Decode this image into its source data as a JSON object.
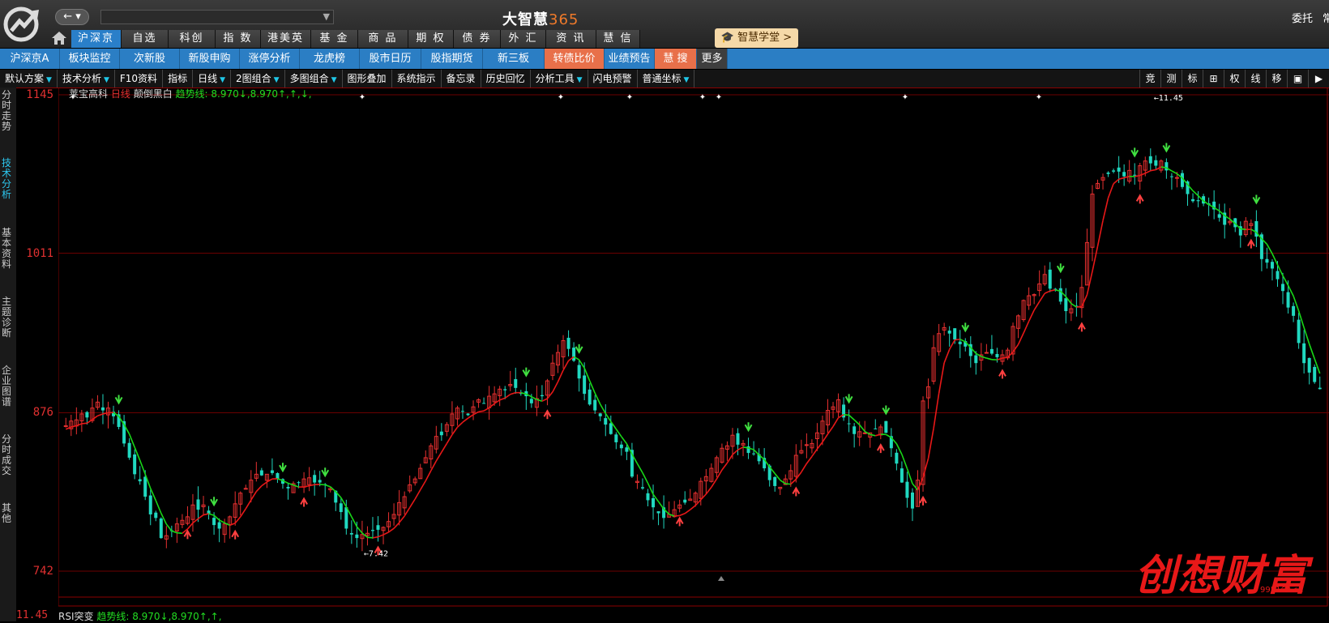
{
  "top": {
    "back_label": "← ▾",
    "app_title_text": "大智慧",
    "app_title_num": "365",
    "weituo": "委托",
    "weituo_cut": "常"
  },
  "main_nav": [
    {
      "label": "沪深京",
      "active": true,
      "dots": true
    },
    {
      "label": "自选股",
      "active": false,
      "dots": false
    },
    {
      "label": "科创板",
      "active": false,
      "dots": false
    },
    {
      "label": "指 数",
      "active": false,
      "dots": false
    },
    {
      "label": "港美英",
      "active": false,
      "dots": true
    },
    {
      "label": "基 金",
      "active": false,
      "dots": false
    },
    {
      "label": "商 品",
      "active": false,
      "dots": true
    },
    {
      "label": "期 权",
      "active": false,
      "dots": false
    },
    {
      "label": "债 券",
      "active": false,
      "dots": false
    },
    {
      "label": "外 汇",
      "active": false,
      "dots": false
    },
    {
      "label": "资 讯",
      "active": false,
      "dots": true
    },
    {
      "label": "慧 信",
      "active": false,
      "dots": false
    }
  ],
  "xuetang_label": "智慧学堂 >",
  "sub_nav": [
    {
      "label": "沪深京A",
      "style": "blue"
    },
    {
      "label": "板块监控",
      "style": "blue"
    },
    {
      "label": "次新股",
      "style": "blue"
    },
    {
      "label": "新股申购",
      "style": "blue"
    },
    {
      "label": "涨停分析",
      "style": "blue"
    },
    {
      "label": "龙虎榜",
      "style": "blue"
    },
    {
      "label": "股市日历",
      "style": "blue"
    },
    {
      "label": "股指期货",
      "style": "blue"
    },
    {
      "label": "新三板",
      "style": "blue"
    },
    {
      "label": "转债比价",
      "style": "orange"
    },
    {
      "label": "业绩预告",
      "style": "blue"
    },
    {
      "label": "慧 搜",
      "style": "orange"
    },
    {
      "label": "更多",
      "style": "gray"
    }
  ],
  "toolbar": [
    {
      "label": "默认方案",
      "arrow": true
    },
    {
      "label": "技术分析",
      "arrow": true
    },
    {
      "label": "F10资料",
      "arrow": false
    },
    {
      "label": "指标",
      "arrow": false
    },
    {
      "label": "日线",
      "arrow": true
    },
    {
      "label": "2图组合",
      "arrow": true
    },
    {
      "label": "多图组合",
      "arrow": true
    },
    {
      "label": "图形叠加",
      "arrow": false
    },
    {
      "label": "系统指示",
      "arrow": false
    },
    {
      "label": "备忘录",
      "arrow": false
    },
    {
      "label": "历史回忆",
      "arrow": false
    },
    {
      "label": "分析工具",
      "arrow": true
    },
    {
      "label": "闪电预警",
      "arrow": false
    },
    {
      "label": "普通坐标",
      "arrow": true
    }
  ],
  "toolbar_right": [
    "竞",
    "测",
    "标",
    "⊞",
    "权",
    "线",
    "移",
    "▣",
    "▶"
  ],
  "left_tabs": [
    {
      "label": "分时走势",
      "active": false
    },
    {
      "label": "技术分析",
      "active": true
    },
    {
      "label": "基本资料",
      "active": false
    },
    {
      "label": "主题诊断",
      "active": false
    },
    {
      "label": "企业图谱",
      "active": false
    },
    {
      "label": "分时成交",
      "active": false
    },
    {
      "label": "其他",
      "active": false
    }
  ],
  "info": {
    "stock_name": "莱宝高科",
    "period": "日线",
    "mode": "颠倒黑白",
    "trend_label": "趋势线:",
    "trend_vals": "8.970↓,8.970↑,↑,↓,"
  },
  "bottom": {
    "indicator": "RSI突变",
    "trend_label": "趋势线:",
    "trend_vals": "8.970↓,8.970↑,↑,",
    "value": "11.45"
  },
  "watermark": {
    "text": "创想财富",
    "url": "995168.cn"
  },
  "chart_data": {
    "type": "candlestick",
    "y_ticks": [
      "1145",
      "1011",
      "876",
      "742"
    ],
    "ylim": [
      742,
      1145
    ],
    "high_label": "11.45",
    "low_label": "7.42",
    "colors": {
      "up": "#e83030",
      "down": "#20d8c0",
      "trend_up": "#e81818",
      "trend_down": "#18d818"
    },
    "close": [
      865,
      869,
      870,
      875,
      872,
      880,
      885,
      878,
      880,
      873,
      864,
      850,
      838,
      824,
      818,
      805,
      790,
      787,
      770,
      772,
      776,
      782,
      785,
      788,
      798,
      794,
      798,
      790,
      781,
      778,
      782,
      788,
      799,
      808,
      812,
      819,
      824,
      823,
      824,
      825,
      820,
      816,
      812,
      816,
      817,
      820,
      821,
      817,
      817,
      815,
      812,
      800,
      792,
      778,
      773,
      770,
      773,
      774,
      776,
      777,
      779,
      784,
      790,
      800,
      805,
      815,
      820,
      829,
      838,
      848,
      856,
      857,
      866,
      875,
      880,
      877,
      874,
      881,
      887,
      884,
      890,
      892,
      896,
      895,
      900,
      897,
      892,
      890,
      884,
      888,
      890,
      903,
      918,
      927,
      937,
      930,
      920,
      905,
      892,
      883,
      878,
      873,
      866,
      858,
      851,
      846,
      843,
      822,
      818,
      812,
      802,
      796,
      791,
      787,
      790,
      794,
      798,
      800,
      803,
      808,
      818,
      822,
      829,
      838,
      846,
      848,
      857,
      849,
      850,
      842,
      841,
      835,
      829,
      819,
      814,
      813,
      820,
      827,
      840,
      844,
      849,
      850,
      859,
      869,
      878,
      881,
      887,
      872,
      867,
      858,
      860,
      859,
      859,
      862,
      864,
      859,
      846,
      833,
      817,
      804,
      795,
      819,
      886,
      898,
      931,
      943,
      948,
      943,
      938,
      934,
      932,
      924,
      918,
      925,
      927,
      926,
      923,
      925,
      929,
      949,
      958,
      971,
      975,
      976,
      985,
      993,
      981,
      980,
      970,
      962,
      964,
      966,
      982,
      1020,
      1061,
      1070,
      1075,
      1078,
      1080,
      1080,
      1076,
      1081,
      1077,
      1085,
      1089,
      1087,
      1085,
      1089,
      1081,
      1076,
      1075,
      1067,
      1061,
      1055,
      1055,
      1053,
      1052,
      1048,
      1041,
      1035,
      1038,
      1033,
      1026,
      1038,
      1036,
      1025,
      1006,
      1003,
      998,
      989,
      979,
      965,
      958,
      935,
      918,
      910,
      902,
      896
    ]
  }
}
